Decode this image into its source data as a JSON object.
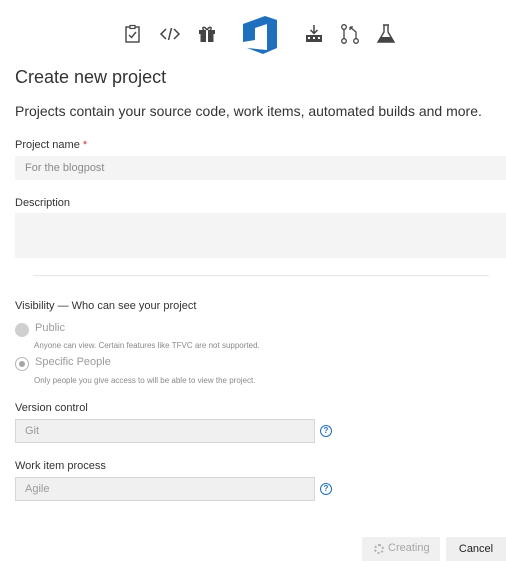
{
  "top_nav": {
    "icons": [
      "boards-icon",
      "code-icon",
      "artifacts-icon",
      "azure-devops-logo-icon",
      "pipelines-icon",
      "repos-icon",
      "test-plans-icon"
    ],
    "accent": "#1f6fbf"
  },
  "page": {
    "title": "Create new project",
    "subtitle": "Projects contain your source code, work items, automated builds and more."
  },
  "form": {
    "project_name": {
      "label": "Project name",
      "required_mark": "*",
      "value": "For the blogpost"
    },
    "description": {
      "label": "Description",
      "value": ""
    },
    "visibility": {
      "label": "Visibility — Who can see your project",
      "options": [
        {
          "label": "Public",
          "description": "Anyone can view. Certain features like TFVC are not supported.",
          "selected": false
        },
        {
          "label": "Specific People",
          "description": "Only people you give access to will be able to view the project.",
          "selected": true
        }
      ]
    },
    "version_control": {
      "label": "Version control",
      "value": "Git",
      "help": "?"
    },
    "work_item_process": {
      "label": "Work item process",
      "value": "Agile",
      "help": "?"
    }
  },
  "actions": {
    "creating_label": "Creating",
    "cancel_label": "Cancel"
  }
}
